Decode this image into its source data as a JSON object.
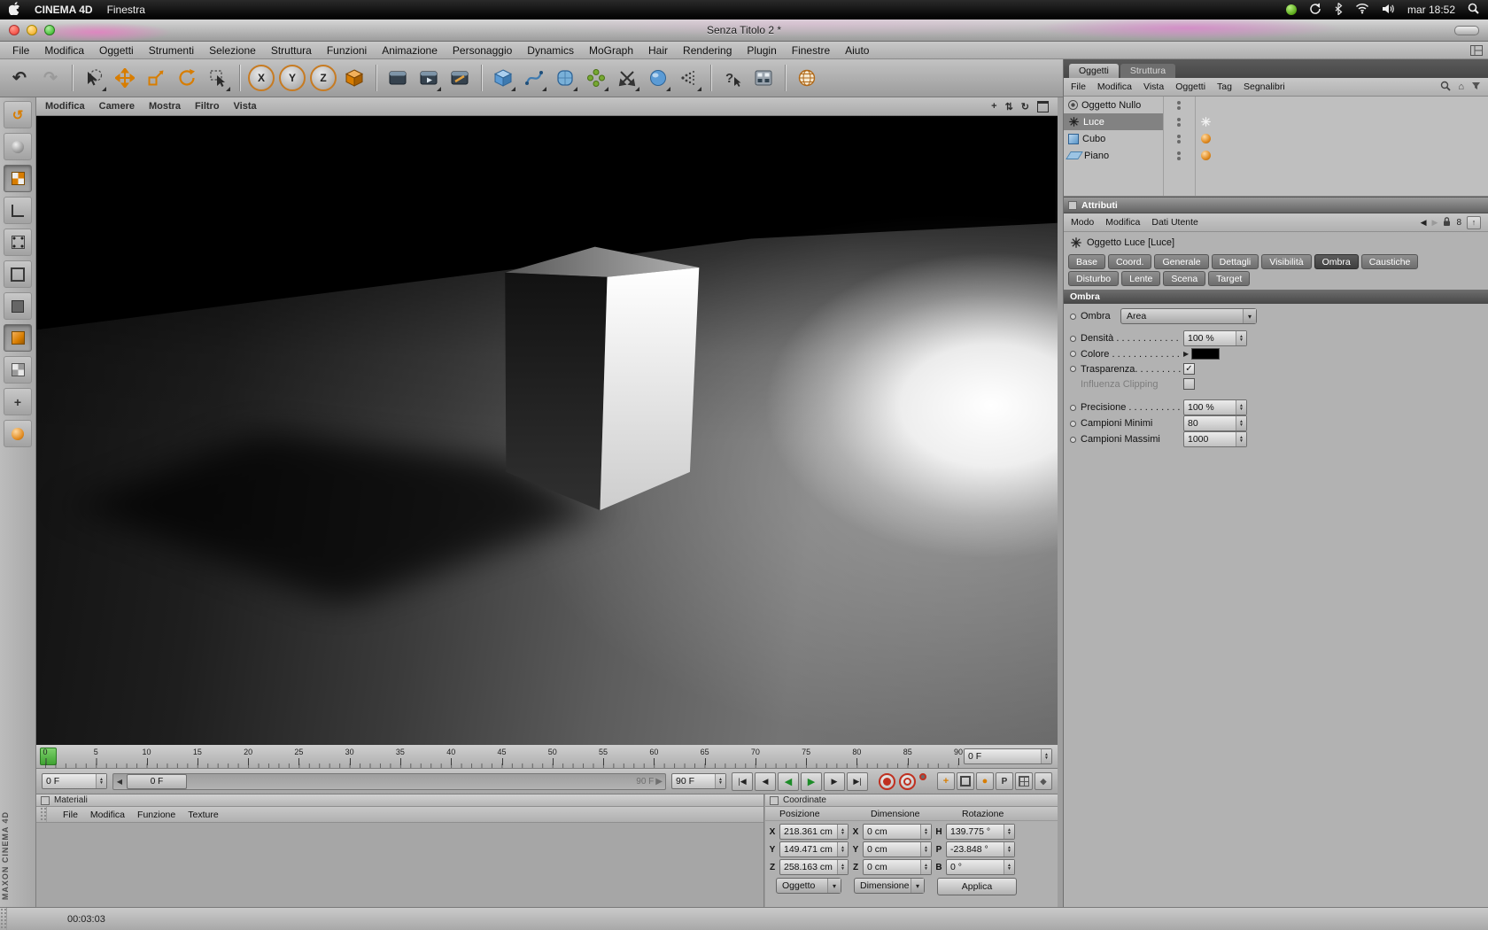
{
  "macbar": {
    "app_name": "CINEMA 4D",
    "menus": [
      "Finestra"
    ],
    "clock": "mar 18:52"
  },
  "window": {
    "title": "Senza Titolo 2 *"
  },
  "appmenu": {
    "items": [
      "File",
      "Modifica",
      "Oggetti",
      "Strumenti",
      "Selezione",
      "Struttura",
      "Funzioni",
      "Animazione",
      "Personaggio",
      "Dynamics",
      "MoGraph",
      "Hair",
      "Rendering",
      "Plugin",
      "Finestre",
      "Aiuto"
    ]
  },
  "toolbar": {
    "axis_x": "X",
    "axis_y": "Y",
    "axis_z": "Z"
  },
  "palette": {
    "items": [
      "make-editable",
      "model-mode",
      "texture-mode",
      "workplane-mode",
      "points-mode",
      "edges-mode",
      "polygons-mode",
      "animation-mode",
      "texture-axis-mode",
      "object-axis-mode",
      "viewport-solo"
    ],
    "pressed": [
      2,
      7
    ]
  },
  "viewport": {
    "menus": [
      "Modifica",
      "Camere",
      "Mostra",
      "Filtro",
      "Vista"
    ]
  },
  "timeline": {
    "ticks": [
      "0",
      "5",
      "10",
      "15",
      "20",
      "25",
      "30",
      "35",
      "40",
      "45",
      "50",
      "55",
      "60",
      "65",
      "70",
      "75",
      "80",
      "85",
      "90"
    ],
    "frame_field": "0 F",
    "current_field": "0 F",
    "slider_handle": "0 F",
    "slider_end": "90 F",
    "end_field": "90 F"
  },
  "materials": {
    "title": "Materiali",
    "menus": [
      "File",
      "Modifica",
      "Funzione",
      "Texture"
    ]
  },
  "coordinates": {
    "title": "Coordinate",
    "columns": [
      "Posizione",
      "Dimensione",
      "Rotazione"
    ],
    "rows": [
      [
        "X",
        "218.361 cm",
        "X",
        "0 cm",
        "H",
        "139.775 °"
      ],
      [
        "Y",
        "149.471 cm",
        "Y",
        "0 cm",
        "P",
        "-23.848 °"
      ],
      [
        "Z",
        "258.163 cm",
        "Z",
        "0 cm",
        "B",
        "0 °"
      ]
    ],
    "dropdown_left": "Oggetto",
    "dropdown_mid": "Dimensione",
    "apply_button": "Applica"
  },
  "objects": {
    "tabs": [
      {
        "label": "Oggetti",
        "active": true
      },
      {
        "label": "Struttura",
        "active": false
      }
    ],
    "menus": [
      "File",
      "Modifica",
      "Vista",
      "Oggetti",
      "Tag",
      "Segnalibri"
    ],
    "items": [
      {
        "name": "Oggetto Nullo",
        "icon": "null",
        "tag": "",
        "selected": false
      },
      {
        "name": "Luce",
        "icon": "light",
        "tag": "light",
        "selected": true
      },
      {
        "name": "Cubo",
        "icon": "cube",
        "tag": "phong",
        "selected": false
      },
      {
        "name": "Piano",
        "icon": "plane",
        "tag": "phong",
        "selected": false
      }
    ]
  },
  "attributes": {
    "title": "Attributi",
    "menus": [
      "Modo",
      "Modifica",
      "Dati Utente"
    ],
    "history_count": "8",
    "object_title": "Oggetto Luce [Luce]",
    "tabs_row1": [
      "Base",
      "Coord.",
      "Generale",
      "Dettagli",
      "Visibilità",
      "Ombra",
      "Caustiche"
    ],
    "tabs_row2": [
      "Disturbo",
      "Lente",
      "Scena",
      "Target"
    ],
    "active_tab": "Ombra",
    "section_title": "Ombra",
    "params": {
      "ombra": {
        "label": "Ombra",
        "value": "Area"
      },
      "densita": {
        "label": "Densità . . . . . . . . . . . .",
        "value": "100 %"
      },
      "colore": {
        "label": "Colore . . . . . . . . . . . . .",
        "swatch": "#000000"
      },
      "trasparenza": {
        "label": "Trasparenza. . . . . . . . .",
        "checked": true
      },
      "influenza": {
        "label": "Influenza Clipping",
        "checked": false
      },
      "precisione": {
        "label": "Precisione . . . . . . . . . .",
        "value": "100 %"
      },
      "campioni_minimi": {
        "label": "Campioni Minimi",
        "value": "80"
      },
      "campioni_massimi": {
        "label": "Campioni Massimi",
        "value": "1000"
      }
    }
  },
  "statusbar": {
    "time": "00:03:03"
  },
  "branding": {
    "vertical_text": "MAXON CINEMA 4D"
  },
  "icons": {
    "dropdown_arrow": "▾",
    "disclosure": "▶",
    "check": "✓",
    "spin_up": "▲",
    "spin_down": "▼",
    "undo": "↶",
    "redo": "↷",
    "goto_start": "|◀",
    "step_back": "◀",
    "play_backward": "◀",
    "play_forward": "▶",
    "step_forward": "▶",
    "goto_end": "▶|",
    "slider_left": "◀",
    "slider_right": "▶",
    "history_back": "◀",
    "history_forward": "▶",
    "up": "↑",
    "home": "⌂",
    "pan": "+",
    "dolly": "⇅",
    "orbit": "↻",
    "help": "?",
    "key_position": "+",
    "key_rotation": "●",
    "key_parameter": "P",
    "key_mode": "◆"
  }
}
